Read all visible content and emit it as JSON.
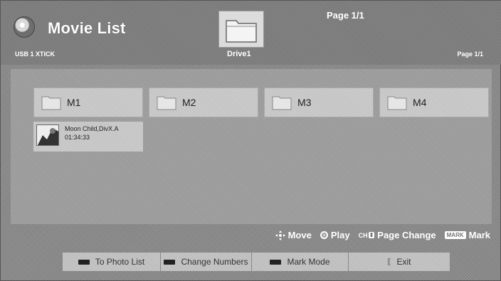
{
  "header": {
    "title": "Movie List",
    "page_top": "Page 1/1",
    "usb": "USB 1 XTICK",
    "drive": "Drive1",
    "page_right": "Page 1/1"
  },
  "folders": [
    {
      "label": "M1"
    },
    {
      "label": "M2"
    },
    {
      "label": "M3"
    },
    {
      "label": "M4"
    }
  ],
  "movies": [
    {
      "name": "Moon Child,DivX.A",
      "time": "01:34:33"
    }
  ],
  "hints": {
    "move": "Move",
    "play": "Play",
    "ch": "CH",
    "page_change": "Page Change",
    "mark_badge": "MARK",
    "mark": "Mark"
  },
  "bottom_bar": {
    "to_photo_list": "To Photo List",
    "change_numbers": "Change Numbers",
    "mark_mode": "Mark Mode",
    "exit": "Exit"
  },
  "icons": [
    "app-disc-icon",
    "folder-icon",
    "move-arrows-icon",
    "play-icon",
    "channel-icon",
    "mark-icon",
    "exit-icon"
  ]
}
